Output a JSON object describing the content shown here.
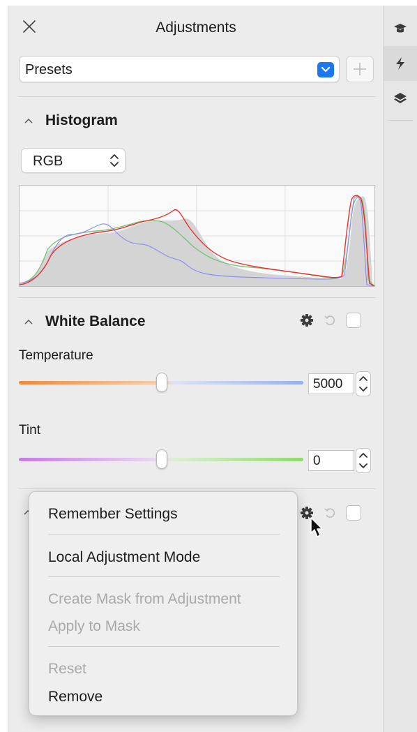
{
  "panel": {
    "title": "Adjustments",
    "presets": {
      "value": "Presets"
    }
  },
  "histogram": {
    "title": "Histogram",
    "channel": "RGB"
  },
  "white_balance": {
    "title": "White Balance",
    "temperature": {
      "label": "Temperature",
      "value": "5000",
      "level": 0.5
    },
    "tint": {
      "label": "Tint",
      "value": "0",
      "level": 0.5
    }
  },
  "context_menu": {
    "items": [
      {
        "label": "Remember Settings",
        "enabled": true
      },
      {
        "label": "Local Adjustment Mode",
        "enabled": true
      },
      {
        "label": "Create Mask from Adjustment",
        "enabled": false
      },
      {
        "label": "Apply to Mask",
        "enabled": false
      },
      {
        "label": "Reset",
        "enabled": false
      },
      {
        "label": "Remove",
        "enabled": true
      }
    ]
  },
  "colors": {
    "accent": "#1a79f0",
    "histogram_red": "#e8312f",
    "histogram_green": "#7cc07c",
    "histogram_blue": "#8f8ff0",
    "histogram_fill": "#d4d4d4"
  },
  "icons": {
    "close": "close-icon",
    "rail": [
      "graduation-cap-icon",
      "lightning-icon",
      "layers-icon"
    ],
    "presets_dropdown": "chevron-down-icon",
    "add": "plus-icon",
    "channel_select": "updown-chevron-icon",
    "section_toggle": "caret-up-icon",
    "gear": "gear-icon",
    "reset": "undo-icon",
    "pointer": "mouse-pointer-icon"
  }
}
